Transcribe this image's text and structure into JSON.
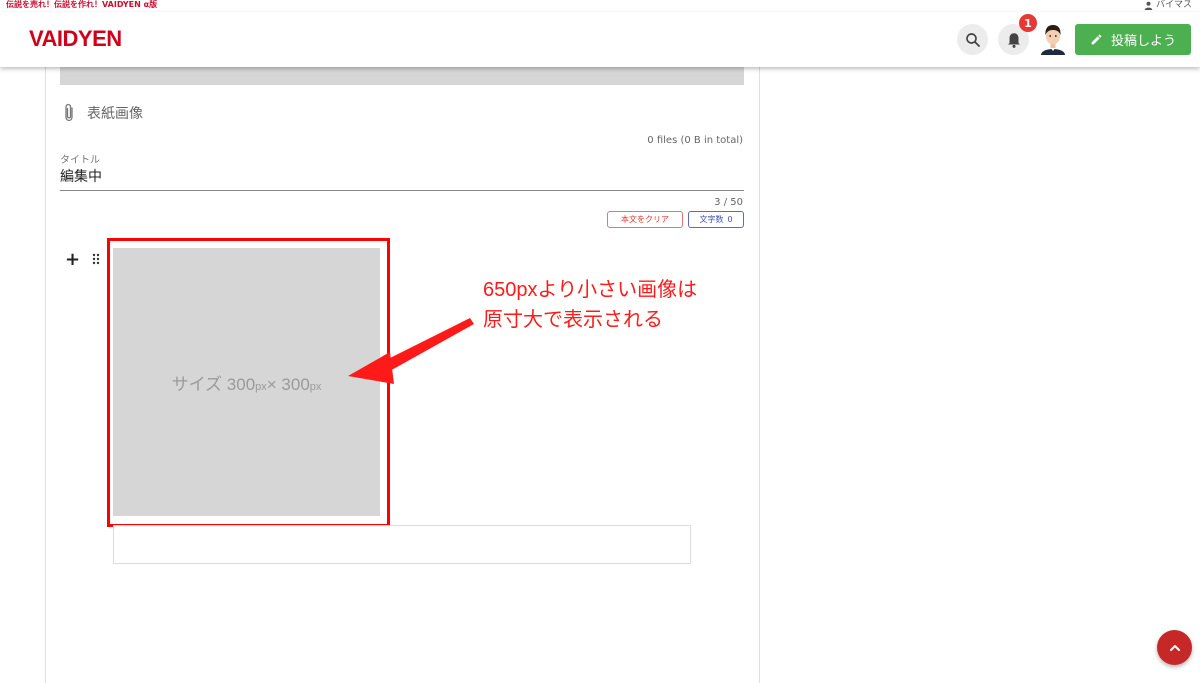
{
  "topbar": {
    "tagline": "伝説を売れ！伝説を作れ！VAIDYEN α版",
    "user_name": "バイマス"
  },
  "header": {
    "logo": "VAIDYEN",
    "notification_count": "1",
    "post_button_label": "投稿しよう"
  },
  "editor": {
    "cover_image_label": "表紙画像",
    "files_info": "0 files (0 B in total)",
    "title_label": "タイトル",
    "title_value": "編集中",
    "char_count": "3 / 50",
    "clear_button_label": "本文をクリア",
    "count_label": "文字数",
    "count_value": "0",
    "image_size_text": {
      "prefix": "サイズ 300",
      "unit1": "px",
      "middle": "× 300",
      "unit2": "px"
    }
  },
  "annotation": {
    "line1": "650pxより小さい画像は",
    "line2": "原寸大で表示される"
  },
  "colors": {
    "brand_red": "#d0021b",
    "post_green": "#4caf50",
    "annotation_red": "#ff1a1a",
    "scroll_top_red": "#c62828"
  }
}
